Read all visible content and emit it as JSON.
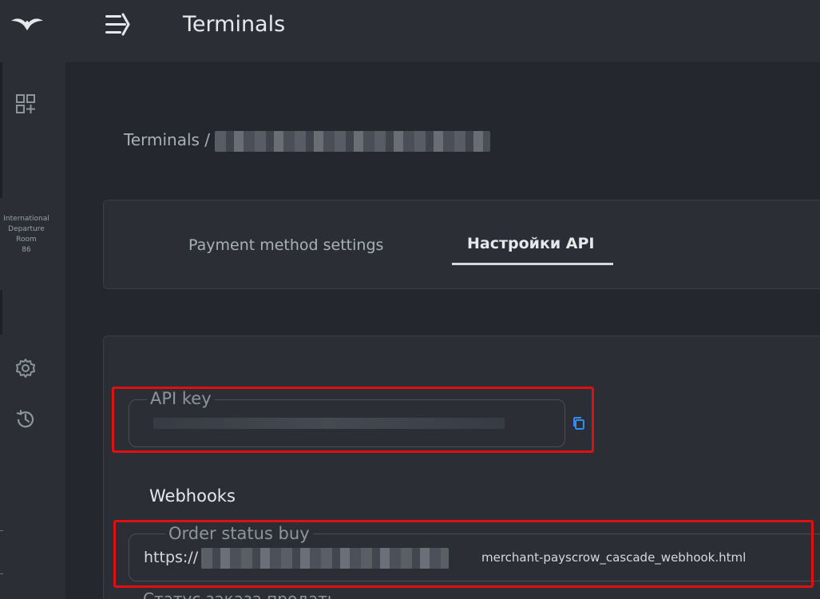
{
  "header": {
    "title": "Terminals",
    "logo_icon": "bird-logo-icon",
    "menu_icon": "menu-collapse-icon"
  },
  "sidebar": {
    "items": [
      {
        "icon": "dashboard-add-icon"
      },
      {
        "icon": "gear-icon"
      },
      {
        "icon": "history-icon"
      }
    ],
    "caption_lines": [
      "International",
      "Departure",
      "Room",
      "86"
    ]
  },
  "breadcrumb": {
    "root": "Terminals /"
  },
  "tabs": [
    {
      "label": "Payment method settings",
      "active": false
    },
    {
      "label": "Настройки API",
      "active": true
    }
  ],
  "api_section": {
    "api_key_label": "API key",
    "copy_icon": "copy-icon"
  },
  "webhooks": {
    "title": "Webhooks",
    "order_status_buy_label": "Order status buy",
    "url_prefix": "https://",
    "url_suffix": "merchant-payscrow_cascade_webhook.html",
    "next_label": "Статус заказа продать"
  },
  "colors": {
    "highlight": "#e01010",
    "accent_blue": "#2f8ef0",
    "background": "#24272e",
    "panel": "#2b2e35"
  }
}
